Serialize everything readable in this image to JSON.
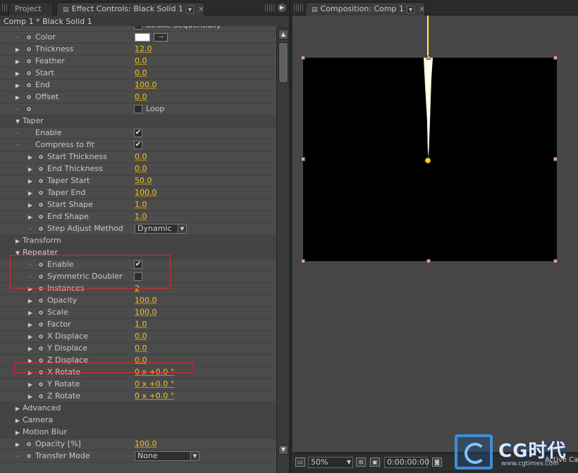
{
  "left_panel": {
    "tabs": {
      "project": "Project",
      "effect_controls": "Effect Controls: Black Solid 1"
    },
    "subheader": "Comp 1 * Black Solid 1",
    "rows": [
      {
        "type": "checkbox",
        "indent": 1,
        "label": "",
        "checked": false,
        "check_label": "Stroke Sequentially"
      },
      {
        "type": "color",
        "indent": 1,
        "label": "Color",
        "color": "#ffffff"
      },
      {
        "type": "value",
        "indent": 1,
        "label": "Thickness",
        "value": "12.0"
      },
      {
        "type": "value",
        "indent": 1,
        "label": "Feather",
        "value": "0.0"
      },
      {
        "type": "value",
        "indent": 1,
        "label": "Start",
        "value": "0.0"
      },
      {
        "type": "value",
        "indent": 1,
        "label": "End",
        "value": "100.0"
      },
      {
        "type": "value",
        "indent": 1,
        "label": "Offset",
        "value": "0.0"
      },
      {
        "type": "checkbox-sw",
        "indent": 1,
        "label": "",
        "checked": false,
        "check_label": "Loop"
      },
      {
        "type": "section",
        "indent": 0,
        "label": "Taper",
        "open": true
      },
      {
        "type": "checkbox-plain",
        "indent": 1,
        "label": "Enable",
        "checked": true
      },
      {
        "type": "checkbox-plain",
        "indent": 1,
        "label": "Compress to fit",
        "checked": true
      },
      {
        "type": "value",
        "indent": 2,
        "label": "Start Thickness",
        "value": "0.0"
      },
      {
        "type": "value",
        "indent": 2,
        "label": "End Thickness",
        "value": "0.0"
      },
      {
        "type": "value",
        "indent": 2,
        "label": "Taper Start",
        "value": "50.0"
      },
      {
        "type": "value",
        "indent": 2,
        "label": "Taper End",
        "value": "100.0"
      },
      {
        "type": "value",
        "indent": 2,
        "label": "Start Shape",
        "value": "1.0"
      },
      {
        "type": "value",
        "indent": 2,
        "label": "End Shape",
        "value": "1.0"
      },
      {
        "type": "dropdown",
        "indent": 2,
        "label": "Step Adjust Method",
        "value": "Dynamic"
      },
      {
        "type": "section",
        "indent": 0,
        "label": "Transform",
        "open": false
      },
      {
        "type": "section",
        "indent": 0,
        "label": "Repeater",
        "open": true
      },
      {
        "type": "checkbox-sw",
        "indent": 2,
        "label": "Enable",
        "checked": true
      },
      {
        "type": "checkbox-sw",
        "indent": 2,
        "label": "Symmetric Doubler",
        "checked": false
      },
      {
        "type": "value",
        "indent": 2,
        "label": "Instances",
        "value": "2"
      },
      {
        "type": "value",
        "indent": 2,
        "label": "Opacity",
        "value": "100.0"
      },
      {
        "type": "value",
        "indent": 2,
        "label": "Scale",
        "value": "100.0"
      },
      {
        "type": "value",
        "indent": 2,
        "label": "Factor",
        "value": "1.0"
      },
      {
        "type": "value",
        "indent": 2,
        "label": "X Displace",
        "value": "0.0"
      },
      {
        "type": "value",
        "indent": 2,
        "label": "Y Displace",
        "value": "0.0"
      },
      {
        "type": "value",
        "indent": 2,
        "label": "Z Displace",
        "value": "0.0"
      },
      {
        "type": "value",
        "indent": 2,
        "label": "X Rotate",
        "value": "0 x +0.0 °"
      },
      {
        "type": "value",
        "indent": 2,
        "label": "Y Rotate",
        "value": "0 x +0.0 °"
      },
      {
        "type": "value",
        "indent": 2,
        "label": "Z Rotate",
        "value": "0 x +0.0 °"
      },
      {
        "type": "section",
        "indent": 0,
        "label": "Advanced",
        "open": false
      },
      {
        "type": "section",
        "indent": 0,
        "label": "Camera",
        "open": false
      },
      {
        "type": "section",
        "indent": 0,
        "label": "Motion Blur",
        "open": false
      },
      {
        "type": "value",
        "indent": 1,
        "label": "Opacity [%]",
        "value": "100.0"
      },
      {
        "type": "dropdown",
        "indent": 1,
        "label": "Transfer Mode",
        "value": "None"
      }
    ]
  },
  "right_panel": {
    "tab": "Composition: Comp 1",
    "zoom": "50%",
    "timecode": "0:00:00:00",
    "camera": "Active Ca"
  },
  "watermark": {
    "text": "CG时代",
    "url": "www.cgtimes.com"
  },
  "colors": {
    "value": "#f3c320",
    "highlight_box": "#e0232a",
    "stroke": "#fffbd0"
  }
}
